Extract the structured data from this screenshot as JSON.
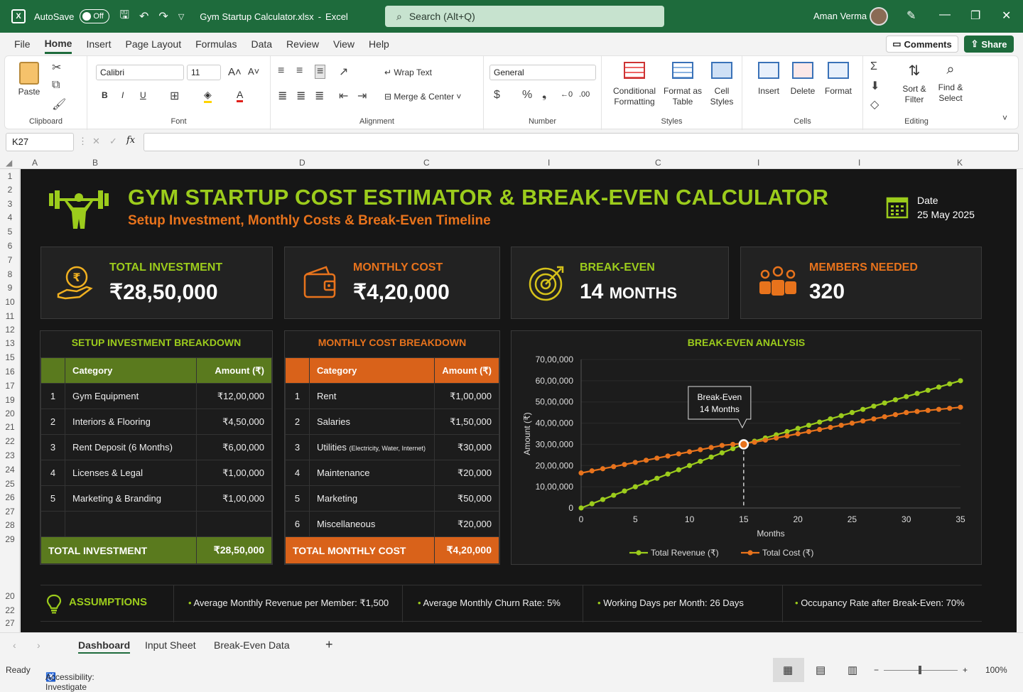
{
  "titlebar": {
    "autosave": "AutoSave",
    "toggle": "Off",
    "filename": "Gym Startup Calculator.xlsx",
    "app": "Excel",
    "search_placeholder": "Search (Alt+Q)",
    "user": "Aman Verma"
  },
  "menu": [
    "File",
    "Home",
    "Insert",
    "Page Layout",
    "Formulas",
    "Data",
    "Review",
    "View",
    "Help"
  ],
  "menu_active": "Home",
  "comments": "Comments",
  "share": "Share",
  "ribbon": {
    "clipboard": {
      "label": "Clipboard",
      "paste": "Paste"
    },
    "font": {
      "label": "Font",
      "name": "Calibri",
      "size": "11",
      "bold": "B",
      "italic": "I",
      "underline": "U"
    },
    "alignment": {
      "label": "Alignment",
      "wrap": "Wrap Text",
      "merge": "Merge & Center"
    },
    "number": {
      "label": "Number",
      "format": "General"
    },
    "styles": {
      "label": "Styles",
      "conditional": "Conditional Formatting",
      "format_table": "Format as Table",
      "cell_styles": "Cell Styles"
    },
    "cells": {
      "label": "Cells",
      "insert": "Insert",
      "delete": "Delete",
      "format": "Format"
    },
    "editing": {
      "label": "Editing",
      "sort": "Sort & Filter",
      "find": "Find & Select"
    }
  },
  "namebox": "K27",
  "columns": [
    "A",
    "B",
    "D",
    "C",
    "I",
    "C",
    "I",
    "I",
    "K"
  ],
  "rows": [
    "1",
    "2",
    "3",
    "4",
    "5",
    "6",
    "7",
    "8",
    "9",
    "10",
    "11",
    "12",
    "13",
    "15",
    "16",
    "17",
    "19",
    "20",
    "21",
    "22",
    "23",
    "24",
    "25",
    "26",
    "27",
    "28",
    "29",
    "20",
    "22",
    "27"
  ],
  "dashboard": {
    "title": "GYM STARTUP COST ESTIMATOR & BREAK-EVEN CALCULATOR",
    "subtitle": "Setup Investment, Monthly Costs & Break-Even Timeline",
    "date_label": "Date",
    "date_value": "25 May 2025",
    "kpis": [
      {
        "label": "TOTAL INVESTMENT",
        "value": "₹28,50,000",
        "color": "#9ccc1c"
      },
      {
        "label": "MONTHLY COST",
        "value": "₹4,20,000",
        "color": "#e8731c"
      },
      {
        "label": "BREAK-EVEN",
        "value": "14",
        "unit": "MONTHS",
        "color": "#9ccc1c"
      },
      {
        "label": "MEMBERS NEEDED",
        "value": "320",
        "color": "#e8731c"
      }
    ],
    "setup": {
      "title": "SETUP INVESTMENT BREAKDOWN",
      "col1": "Category",
      "col2": "Amount (₹)",
      "rows": [
        [
          "1",
          "Gym Equipment",
          "₹12,00,000"
        ],
        [
          "2",
          "Interiors & Flooring",
          "₹4,50,000"
        ],
        [
          "3",
          "Rent Deposit (6 Months)",
          "₹6,00,000"
        ],
        [
          "4",
          "Licenses & Legal",
          "₹1,00,000"
        ],
        [
          "5",
          "Marketing & Branding",
          "₹1,00,000"
        ]
      ],
      "total_label": "TOTAL INVESTMENT",
      "total_value": "₹28,50,000"
    },
    "monthly": {
      "title": "MONTHLY COST BREAKDOWN",
      "col1": "Category",
      "col2": "Amount (₹)",
      "rows": [
        [
          "1",
          "Rent",
          "₹1,00,000"
        ],
        [
          "2",
          "Salaries",
          "₹1,50,000"
        ],
        [
          "3",
          "Utilities",
          "₹30,000"
        ],
        [
          "4",
          "Maintenance",
          "₹20,000"
        ],
        [
          "5",
          "Marketing",
          "₹50,000"
        ],
        [
          "6",
          "Miscellaneous",
          "₹20,000"
        ]
      ],
      "utilities_note": "(Electricity, Water, Internet)",
      "total_label": "TOTAL MONTHLY COST",
      "total_value": "₹4,20,000"
    },
    "assumptions": {
      "label": "ASSUMPTIONS",
      "items": [
        "Average Monthly Revenue per Member: ₹1,500",
        "Average Monthly Churn Rate: 5%",
        "Working Days per Month: 26 Days",
        "Occupancy Rate after Break-Even: 70%"
      ]
    }
  },
  "chart_data": {
    "type": "line",
    "title": "BREAK-EVEN ANALYSIS",
    "xlabel": "Months",
    "ylabel": "Amount (₹)",
    "xlim": [
      0,
      35
    ],
    "ylim": [
      0,
      7000000
    ],
    "xticks": [
      "0",
      "5",
      "10",
      "15",
      "20",
      "25",
      "30",
      "35"
    ],
    "yticks": [
      "0",
      "10,00,000",
      "20,00,000",
      "30,00,000",
      "40,00,000",
      "50,00,000",
      "60,00,000",
      "70,00,000"
    ],
    "series": [
      {
        "name": "Total Revenue (₹)",
        "color": "#9ccc1c",
        "x": [
          0,
          1,
          2,
          3,
          4,
          5,
          6,
          7,
          8,
          9,
          10,
          11,
          12,
          13,
          14,
          15,
          16,
          17,
          18,
          19,
          20,
          21,
          22,
          23,
          24,
          25,
          26,
          27,
          28,
          29,
          30,
          31,
          32,
          33,
          34,
          35
        ],
        "values": [
          0,
          200000,
          400000,
          600000,
          800000,
          1000000,
          1200000,
          1400000,
          1600000,
          1800000,
          2000000,
          2200000,
          2400000,
          2600000,
          2800000,
          3000000,
          3150000,
          3300000,
          3450000,
          3600000,
          3750000,
          3900000,
          4050000,
          4200000,
          4350000,
          4500000,
          4650000,
          4800000,
          4950000,
          5100000,
          5250000,
          5400000,
          5550000,
          5700000,
          5850000,
          6000000
        ]
      },
      {
        "name": "Total Cost (₹)",
        "color": "#e8731c",
        "x": [
          0,
          1,
          2,
          3,
          4,
          5,
          6,
          7,
          8,
          9,
          10,
          11,
          12,
          13,
          14,
          15,
          16,
          17,
          18,
          19,
          20,
          21,
          22,
          23,
          24,
          25,
          26,
          27,
          28,
          29,
          30,
          31,
          32,
          33,
          34,
          35
        ],
        "values": [
          1650000,
          1750000,
          1850000,
          1950000,
          2050000,
          2150000,
          2250000,
          2350000,
          2450000,
          2550000,
          2650000,
          2750000,
          2850000,
          2950000,
          3000000,
          3050000,
          3100000,
          3200000,
          3300000,
          3400000,
          3500000,
          3600000,
          3700000,
          3800000,
          3900000,
          4000000,
          4100000,
          4200000,
          4300000,
          4400000,
          4500000,
          4550000,
          4600000,
          4650000,
          4700000,
          4750000
        ]
      }
    ],
    "annotation": {
      "text1": "Break-Even",
      "text2": "14 Months",
      "x": 15,
      "y": 3000000
    },
    "legend": "bottom"
  },
  "sheet_tabs": [
    "Dashboard",
    "Input Sheet",
    "Break-Even Data"
  ],
  "active_tab": "Dashboard",
  "status": {
    "ready": "Ready",
    "accessibility": "Accessibility: Investigate",
    "zoom": "100%"
  }
}
